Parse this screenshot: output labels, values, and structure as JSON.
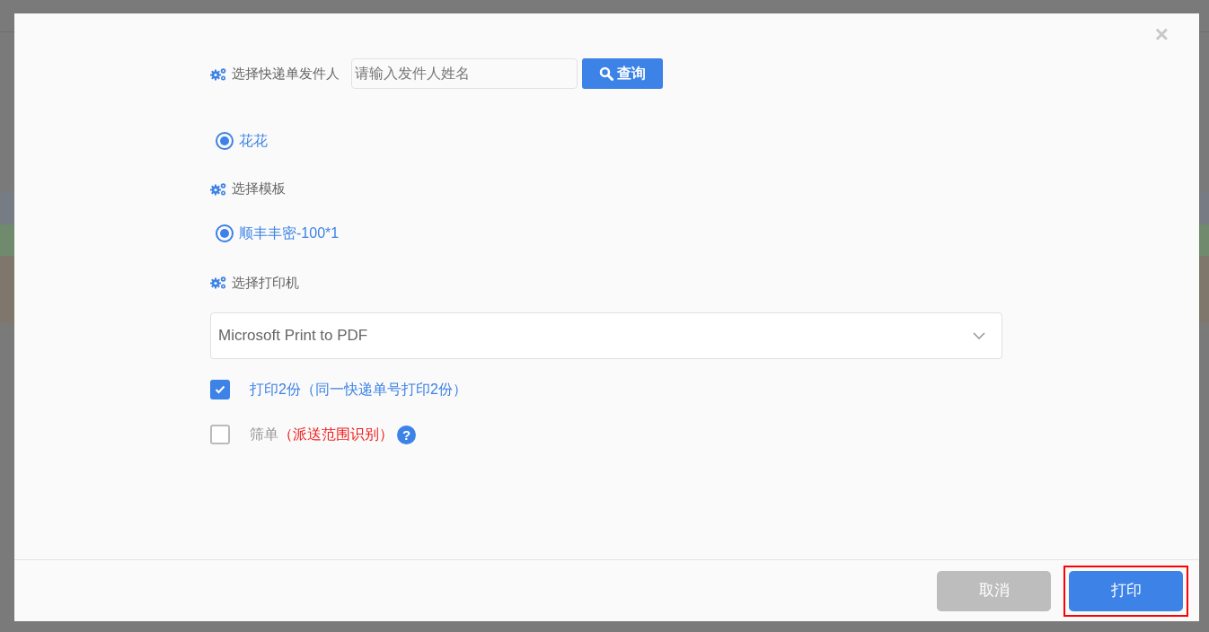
{
  "dialog": {
    "close": "×",
    "sender": {
      "label": "选择快递单发件人",
      "placeholder": "请输入发件人姓名",
      "search_button": "查询"
    },
    "senders": [
      {
        "label": "花花",
        "selected": true
      }
    ],
    "template": {
      "label": "选择模板"
    },
    "templates": [
      {
        "label": "顺丰丰密-100*1",
        "selected": true
      }
    ],
    "printer": {
      "label": "选择打印机",
      "value": "Microsoft Print to PDF"
    },
    "options": [
      {
        "kind": "plain",
        "label": "打印2份（同一快递单号打印2份）",
        "checked": true
      },
      {
        "kind": "note",
        "label": "筛单",
        "note": "（派送范围识别）",
        "checked": false,
        "help": "?"
      }
    ],
    "buttons": [
      {
        "label": "取消",
        "kind": "cancel"
      },
      {
        "label": "打印",
        "kind": "primary",
        "highlighted": true
      }
    ]
  }
}
